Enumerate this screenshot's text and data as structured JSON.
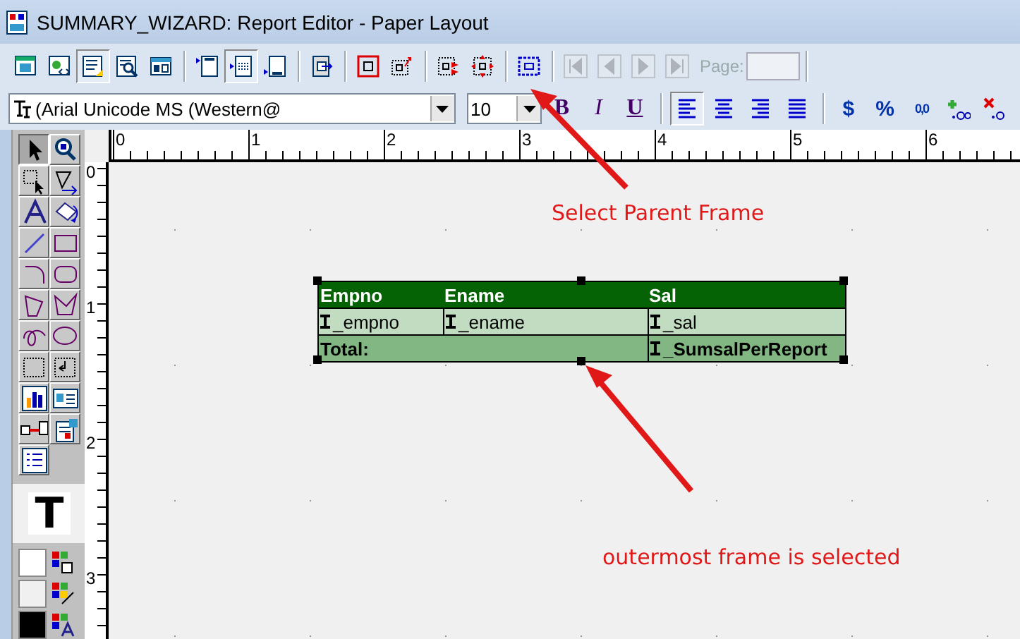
{
  "window": {
    "title": "SUMMARY_WIZARD: Report Editor - Paper Layout"
  },
  "toolbar": {
    "groups": [
      [
        {
          "pressed": false
        },
        {
          "pressed": false
        },
        {
          "pressed": true
        },
        {
          "pressed": false
        },
        {
          "pressed": false
        }
      ],
      [
        {
          "pressed": false
        },
        {
          "pressed": true
        },
        {
          "pressed": false
        }
      ],
      [
        {
          "pressed": false
        }
      ],
      [
        {
          "pressed": false
        },
        {
          "pressed": false
        }
      ],
      [
        {
          "pressed": false
        },
        {
          "pressed": false
        }
      ],
      [
        {
          "pressed": false
        }
      ]
    ],
    "navigation": [
      {
        "disabled": true
      },
      {
        "disabled": true
      },
      {
        "disabled": true
      },
      {
        "disabled": true
      }
    ],
    "page_label": "Page:"
  },
  "format_bar": {
    "font": "(Arial Unicode MS (Western@",
    "size": "10",
    "style_buttons": [
      {
        "label": "B",
        "kind": "bold"
      },
      {
        "label": "I",
        "kind": "italic"
      },
      {
        "label": "U",
        "kind": "underline"
      }
    ],
    "align_buttons": [
      {
        "selected": true
      },
      {
        "selected": false
      },
      {
        "selected": false
      },
      {
        "selected": false
      }
    ],
    "number_buttons": [
      {
        "label": "$"
      },
      {
        "label": "%"
      },
      {
        "label": "0,0"
      }
    ]
  },
  "palette": {
    "tools": [
      {
        "selected": true
      },
      {
        "selected": false
      },
      {
        "selected": false
      },
      {
        "selected": false
      },
      {
        "selected": false
      },
      {
        "selected": false
      },
      {
        "selected": false
      },
      {
        "selected": false
      },
      {
        "selected": false
      },
      {
        "selected": false
      },
      {
        "selected": false
      },
      {
        "selected": false
      },
      {
        "selected": false
      },
      {
        "selected": false
      },
      {
        "selected": false
      },
      {
        "selected": false
      },
      {
        "selected": false
      },
      {
        "selected": false
      },
      {
        "selected": false
      },
      {
        "selected": false
      },
      {
        "selected": false
      }
    ],
    "text_sample": "T",
    "colors": [
      {
        "color": "#ffffff"
      },
      {
        "color": "#f0f0f0"
      },
      {
        "color": "#000000"
      }
    ]
  },
  "rulers": {
    "horizontal": [
      "0",
      "1",
      "2",
      "3",
      "4",
      "5",
      "6"
    ],
    "vertical": [
      "0",
      "1",
      "2",
      "3"
    ]
  },
  "report_frame": {
    "selected": true,
    "header": [
      "Empno",
      "Ename",
      "Sal"
    ],
    "body": [
      "_empno",
      "_ename",
      "_sal"
    ],
    "total": {
      "label": "Total:",
      "field": "_SumsalPerReport"
    }
  },
  "annotations": [
    {
      "text": "Select Parent Frame"
    },
    {
      "text": "outermost frame is selected"
    }
  ]
}
